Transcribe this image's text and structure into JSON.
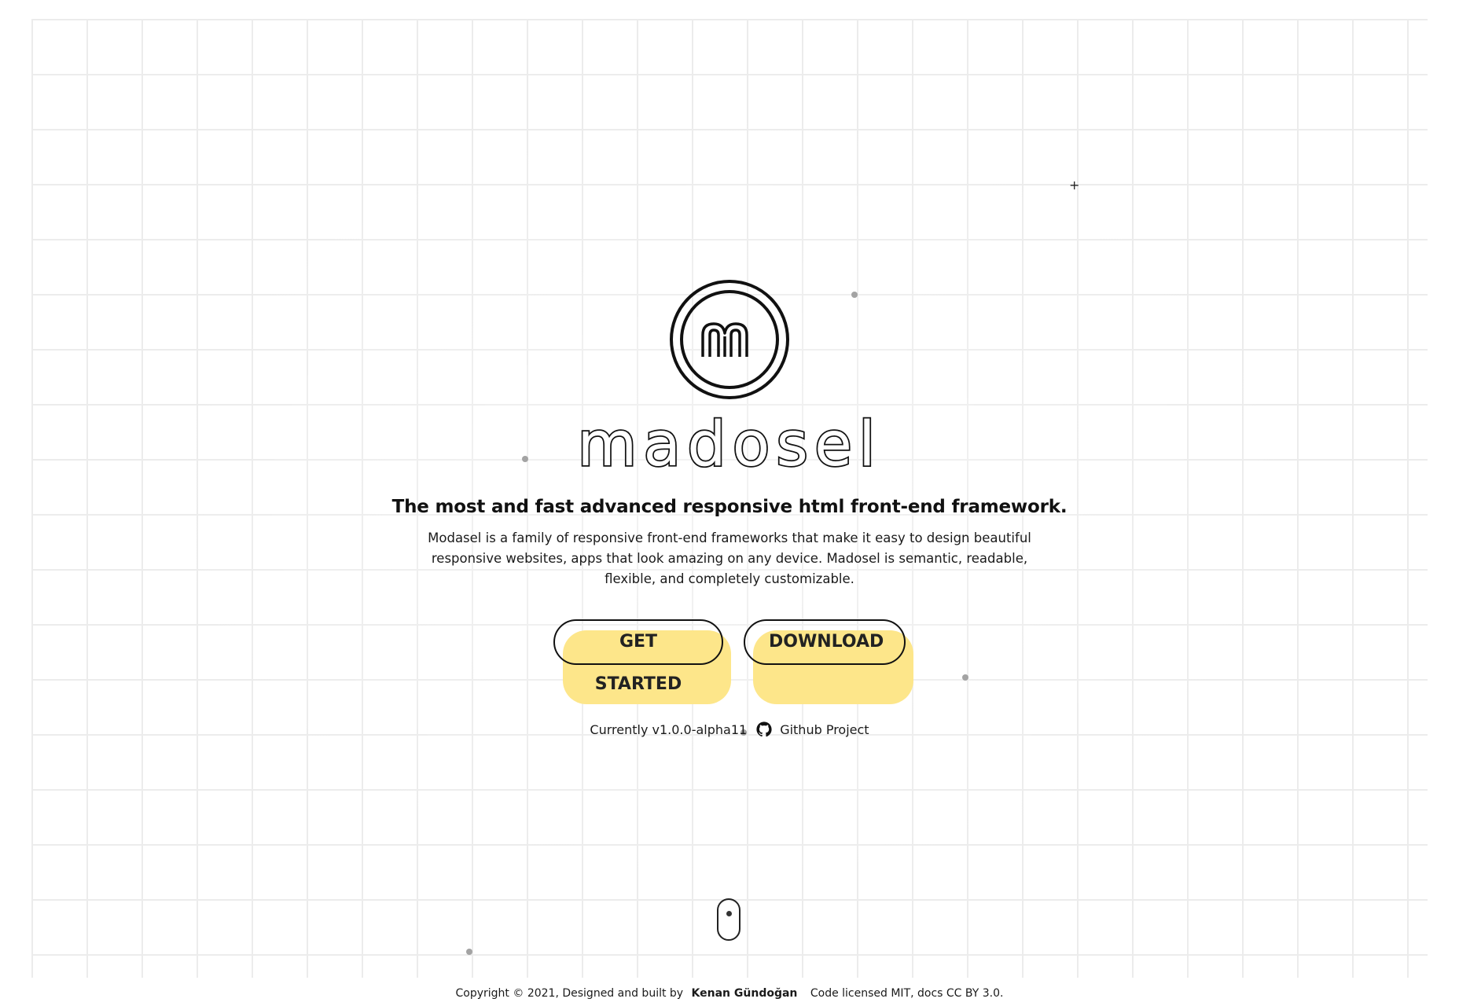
{
  "brand": {
    "logo_letter": "m",
    "wordmark": "madosel"
  },
  "hero": {
    "tagline": "The most and fast advanced responsive html front-end framework.",
    "description": "Modasel is a family of responsive front-end frameworks that make it easy to design beautiful responsive websites, apps that look amazing on any device. Madosel is semantic, readable, flexible, and completely customizable."
  },
  "buttons": {
    "get_started": "GET STARTED",
    "download": "DOWNLOAD"
  },
  "meta": {
    "version": "Currently v1.0.0-alpha11",
    "github_icon": "github-icon",
    "github_label": "Github Project"
  },
  "scroll": {
    "icon": "mouse-scroll-icon"
  },
  "footer": {
    "copyright": "Copyright © 2021, Designed and built by",
    "author": "Kenan Gündoğan",
    "license": "Code licensed MIT, docs CC BY 3.0."
  },
  "colors": {
    "accent": "#fde68a",
    "ink": "#111111",
    "grid": "#ececec"
  }
}
